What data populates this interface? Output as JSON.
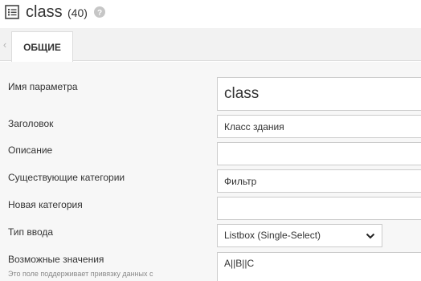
{
  "header": {
    "title": "class",
    "count": "(40)",
    "title_icon": "list-icon",
    "help_icon": "help-icon"
  },
  "tabs": [
    {
      "label": "ОБЩИЕ",
      "active": true
    }
  ],
  "form": {
    "name": {
      "label": "Имя параметра",
      "value": "class"
    },
    "heading": {
      "label": "Заголовок",
      "value": "Класс здания"
    },
    "description": {
      "label": "Описание",
      "value": ""
    },
    "existing_categories": {
      "label": "Существующие категории",
      "value": "Фильтр"
    },
    "new_category": {
      "label": "Новая категория",
      "value": ""
    },
    "input_type": {
      "label": "Тип ввода",
      "value": "Listbox (Single-Select)"
    },
    "possible_values": {
      "label": "Возможные значения",
      "hint": "Это поле поддерживает привязку данных с",
      "value": "A||B||C"
    }
  },
  "colors": {
    "form_background": "#f7f7f7",
    "tabstrip_background": "#f2f2f2",
    "border": "#cccccc"
  }
}
